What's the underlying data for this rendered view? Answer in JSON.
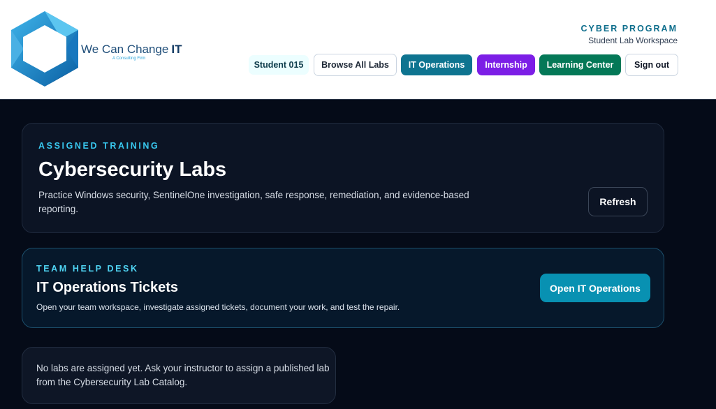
{
  "brand": {
    "name": "We Can Change",
    "name_suffix": "IT",
    "tagline": "A Consulting Firm",
    "logo_icon": "hexagon-logo-icon"
  },
  "header": {
    "program": "CYBER PROGRAM",
    "workspace": "Student Lab Workspace"
  },
  "nav": {
    "student": "Student 015",
    "browse": "Browse All Labs",
    "it_operations": "IT Operations",
    "internship": "Internship",
    "learning_center": "Learning Center",
    "sign_out": "Sign out"
  },
  "training": {
    "eyebrow": "ASSIGNED TRAINING",
    "title": "Cybersecurity Labs",
    "description": "Practice Windows security, SentinelOne investigation, safe response, remediation, and evidence-based reporting.",
    "refresh_label": "Refresh"
  },
  "helpdesk": {
    "eyebrow": "TEAM HELP DESK",
    "title": "IT Operations Tickets",
    "description": "Open your team workspace, investigate assigned tickets, document your work, and test the repair.",
    "button_label": "Open IT Operations"
  },
  "empty_state": {
    "message": "No labs are assigned yet. Ask your instructor to assign a published lab from the Cybersecurity Lab Catalog."
  },
  "colors": {
    "page_bg": "#050b18",
    "accent_cyan": "#38c7ee",
    "it_ops": "#0e7490",
    "internship": "#7c1ee6",
    "learning_center": "#047857"
  }
}
